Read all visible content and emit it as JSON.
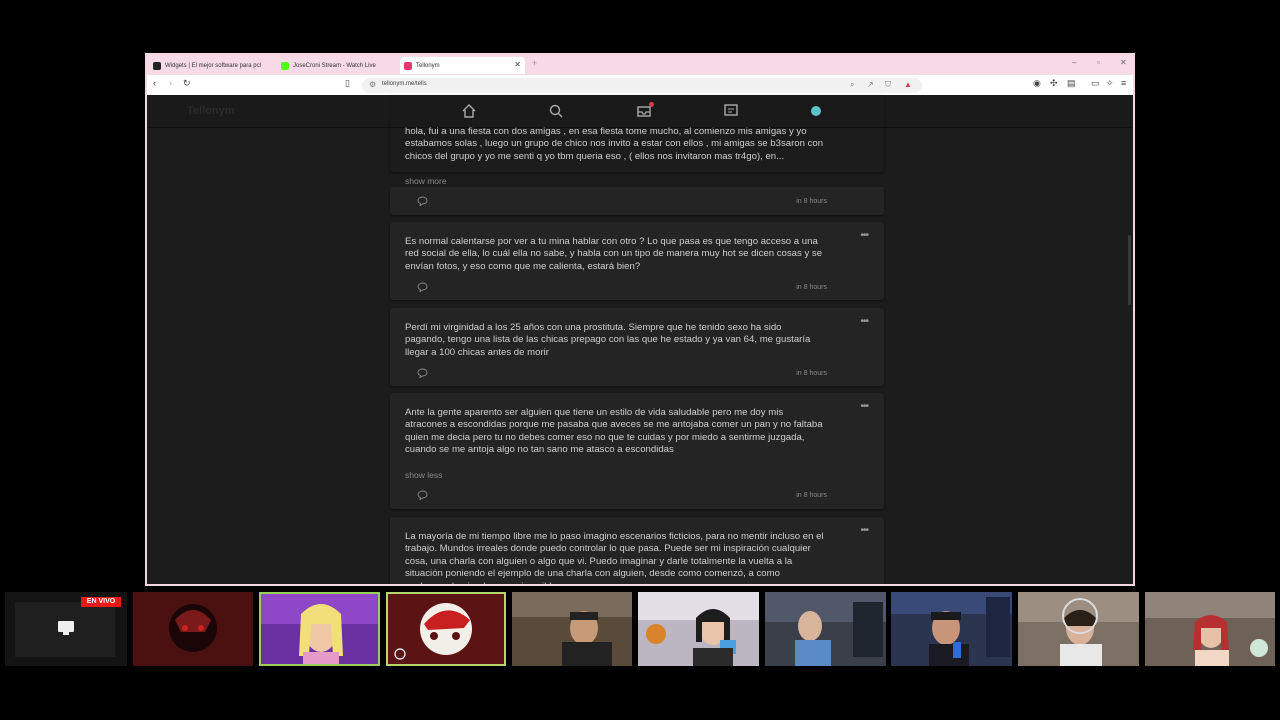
{
  "browser": {
    "tabs": [
      {
        "title": "Widgets | El mejor software para pcl",
        "icon": "github-icon"
      },
      {
        "title": "JoseCroni Stream - Watch Live",
        "icon": "kick-icon"
      },
      {
        "title": "Tellonym",
        "icon": "tellonym-icon"
      }
    ],
    "address": "tellonym.me/tells"
  },
  "site": {
    "logo": "Tellonym"
  },
  "cards": [
    {
      "text": "hola, fui a una fiesta con dos amigas , en esa fiesta tome mucho, al comienzo mis amigas y yo estabamos solas , luego un grupo de chico nos invito a estar con ellos , mi amigas se b3saron con chicos del grupo y yo me senti q yo tbm queria eso , ( ellos nos invitaron mas tr4go), en...",
      "show": "show more",
      "time": "in 8 hours"
    },
    {
      "text": "Es normal calentarse por ver a tu mina hablar con otro ? Lo que pasa es que tengo acceso a una red social de ella, lo cuál ella no sabe, y habla con un tipo de manera muy hot se dicen cosas y se envían fotos, y eso como que me calienta, estará bien?",
      "show": "",
      "time": "in 8 hours"
    },
    {
      "text": "Perdí mi virginidad a los 25 años con una prostituta. Siempre que he tenido sexo ha sido pagando, tengo una lista de las chicas prepago con las que he estado y ya van 64, me gustaría llegar a 100 chicas antes de morir",
      "show": "",
      "time": "in 8 hours"
    },
    {
      "text": "Ante la gente aparento ser alguien que tiene un estilo de vida saludable pero me doy mis atracones a escondidas porque me pasaba que aveces se me antojaba comer un pan y no faltaba quien me decia pero tu no debes comer eso no que te cuidas y por miedo a sentirme juzgada, cuando se me antoja algo no tan sano me atasco a escondidas",
      "show": "show less",
      "time": "in 8 hours"
    },
    {
      "text": "La mayoría de mi tiempo libre me lo paso imagino escenarios ficticios, para no mentir incluso en el trabajo. Mundos irreales donde puedo controlar lo que pasa. Puede ser mi inspiración cualquier cosa, una charla con alguien o algo que vi. Puedo imaginar y darle totalmente la vuelta a la situación poniendo el ejemplo de una charla con alguien, desde como comenzó, a como acabamos haciendo cosas increibles y",
      "show": "",
      "time": ""
    }
  ],
  "stream": {
    "live_label": "EN VIVO"
  }
}
